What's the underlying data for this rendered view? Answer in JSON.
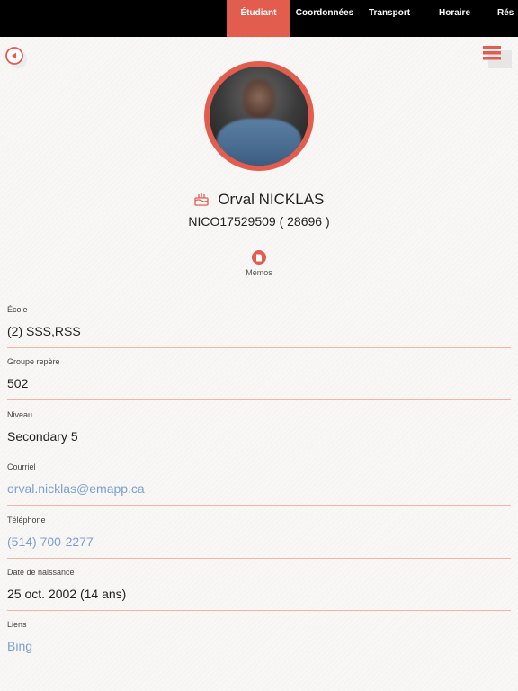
{
  "tabs": [
    {
      "label": "Étudiant",
      "active": true
    },
    {
      "label": "Coordonnées",
      "active": false
    },
    {
      "label": "Transport",
      "active": false
    },
    {
      "label": "Horaire",
      "active": false
    },
    {
      "label": "Rés",
      "active": false
    }
  ],
  "student": {
    "name": "Orval NICKLAS",
    "id_line": "NICO17529509 ( 28696 )"
  },
  "memos": {
    "label": "Mémos"
  },
  "fields": [
    {
      "label": "École",
      "value": "(2) SSS,RSS",
      "link": false
    },
    {
      "label": "Groupe repère",
      "value": "502",
      "link": false
    },
    {
      "label": "Niveau",
      "value": "Secondary 5",
      "link": false
    },
    {
      "label": "Courriel",
      "value": "orval.nicklas@emapp.ca",
      "link": true
    },
    {
      "label": "Téléphone",
      "value": "(514) 700-2277",
      "link": true
    },
    {
      "label": "Date de naissance",
      "value": "25 oct. 2002 (14 ans)",
      "link": false
    },
    {
      "label": "Liens",
      "value": "Bing",
      "link": true
    }
  ],
  "colors": {
    "accent": "#e35d4f",
    "link": "#7d9fd0",
    "divider": "#f0b4a9",
    "topbar": "#000000"
  },
  "icons": {
    "back": "back-arrow-icon",
    "menu": "hamburger-menu-icon",
    "birthday": "birthday-cake-icon",
    "memo": "memo-icon"
  }
}
